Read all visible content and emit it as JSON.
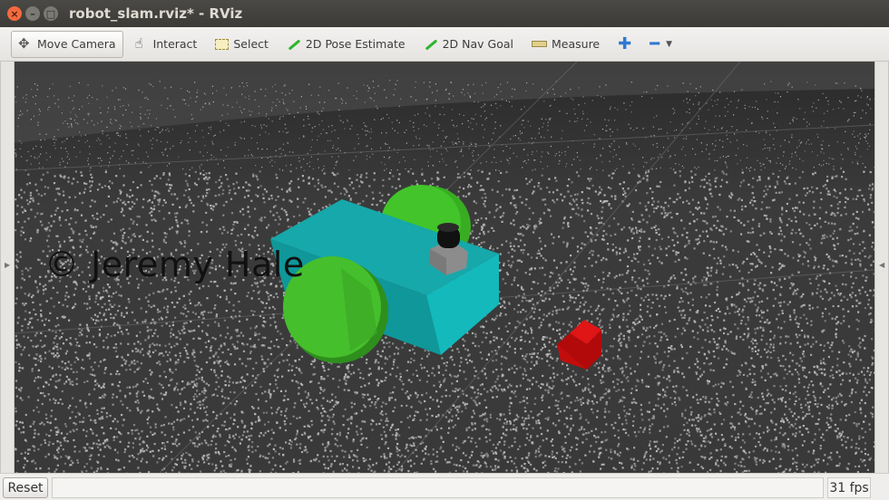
{
  "window": {
    "title": "robot_slam.rviz* - RViz",
    "close_glyph": "×",
    "minimize_glyph": "–",
    "maximize_glyph": "□"
  },
  "toolbar": {
    "tools": [
      {
        "label": "Move Camera",
        "icon": "move-camera-icon",
        "active": true
      },
      {
        "label": "Interact",
        "icon": "hand-icon",
        "active": false
      },
      {
        "label": "Select",
        "icon": "select-icon",
        "active": false
      },
      {
        "label": "2D Pose Estimate",
        "icon": "green-arrow-icon",
        "active": false
      },
      {
        "label": "2D Nav Goal",
        "icon": "green-arrow-icon",
        "active": false
      },
      {
        "label": "Measure",
        "icon": "ruler-icon",
        "active": false
      }
    ],
    "add_glyph": "✚",
    "remove_glyph": "━",
    "dropdown_glyph": "▼"
  },
  "viewport": {
    "watermark": "© Jeremy Hale",
    "colors": {
      "body": "#14b3b5",
      "wheels": "#3ec326",
      "marker": "#d10c0c",
      "sensor_base": "#8a8a8a",
      "sensor_top": "#111111",
      "points": "#bdbdbd",
      "floor": "#393939"
    }
  },
  "side_handles": {
    "left_glyph": "▶",
    "right_glyph": "◀"
  },
  "statusbar": {
    "reset_label": "Reset",
    "status_text": "",
    "fps": "31 fps"
  }
}
